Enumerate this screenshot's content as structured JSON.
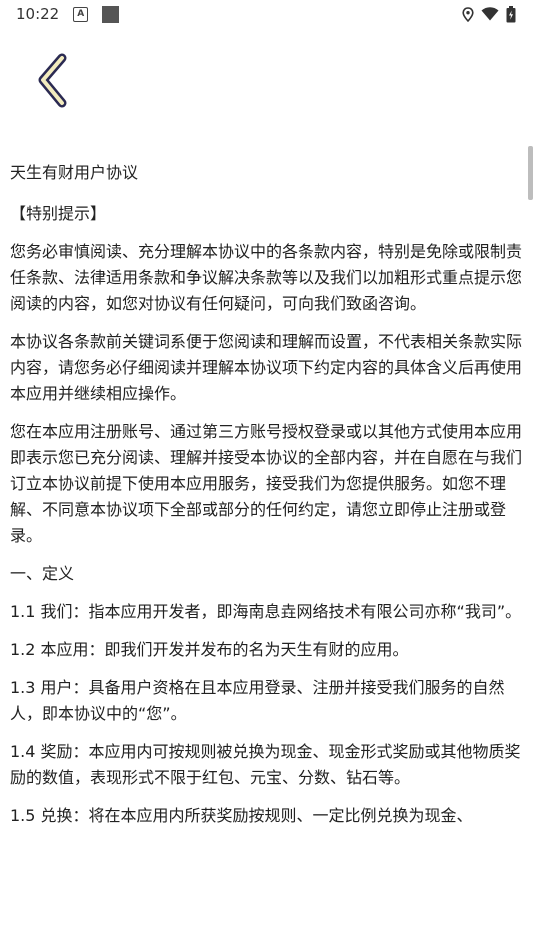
{
  "status_bar": {
    "time": "10:22",
    "icons": [
      "app-a-icon",
      "square-icon",
      "location-icon",
      "wifi-icon",
      "battery-icon"
    ],
    "app_icon_letter": "A"
  },
  "header": {
    "back_icon": "chevron-left-icon",
    "back_icon_stroke": "#2b2a52",
    "back_icon_fill": "#f3ecbf"
  },
  "document": {
    "title": "天生有财用户协议",
    "special_notice": "【特别提示】",
    "paragraphs": [
      "您务必审慎阅读、充分理解本协议中的各条款内容，特别是免除或限制责任条款、法律适用条款和争议解决条款等以及我们以加粗形式重点提示您阅读的内容，如您对协议有任何疑问，可向我们致函咨询。",
      "本协议各条款前关键词系便于您阅读和理解而设置，不代表相关条款实际内容，请您务必仔细阅读并理解本协议项下约定内容的具体含义后再使用本应用并继续相应操作。",
      "您在本应用注册账号、通过第三方账号授权登录或以其他方式使用本应用即表示您已充分阅读、理解并接受本协议的全部内容，并在自愿在与我们订立本协议前提下使用本应用服务，接受我们为您提供服务。如您不理解、不同意本协议项下全部或部分的任何约定，请您立即停止注册或登录。"
    ],
    "section_heading": "一、定义",
    "definitions": [
      "1.1 我们：指本应用开发者，即海南息垚网络技术有限公司亦称“我司”。",
      "1.2 本应用：即我们开发并发布的名为天生有财的应用。",
      "1.3 用户：具备用户资格在且本应用登录、注册并接受我们服务的自然人，即本协议中的“您”。",
      "1.4 奖励：本应用内可按规则被兑换为现金、现金形式奖励或其他物质奖励的数值，表现形式不限于红包、元宝、分数、钻石等。",
      "1.5 兑换：将在本应用内所获奖励按规则、一定比例兑换为现金、"
    ]
  }
}
